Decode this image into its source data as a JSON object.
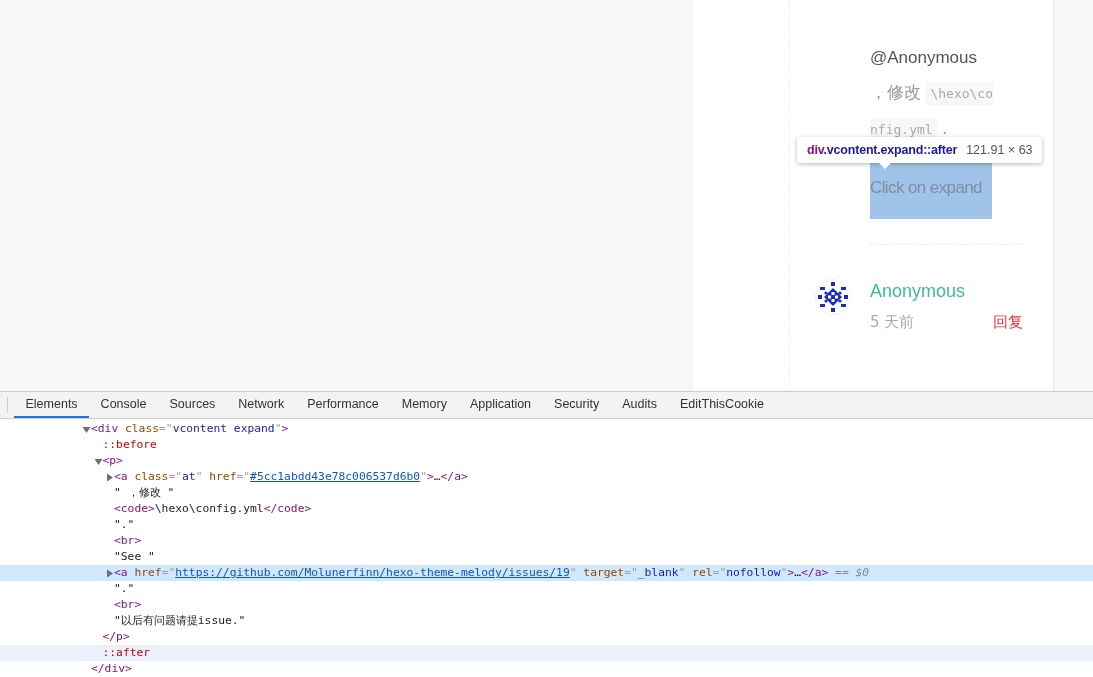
{
  "page": {
    "reply_body": {
      "mention": "@Anonymous",
      "text": " ，修改",
      "code": "\\hexo\\config.yml",
      "end": " ."
    },
    "expand_label": "Click on expand",
    "comment": {
      "author": "Anonymous",
      "time": "5 天前",
      "reply": "回复"
    }
  },
  "inspector_tooltip": {
    "tag": "div",
    "selector": ".vcontent.expand::after",
    "size": "121.91 × 63"
  },
  "devtools": {
    "tabs": [
      {
        "label": "Elements",
        "selected": true
      },
      {
        "label": "Console",
        "selected": false
      },
      {
        "label": "Sources",
        "selected": false
      },
      {
        "label": "Network",
        "selected": false
      },
      {
        "label": "Performance",
        "selected": false
      },
      {
        "label": "Memory",
        "selected": false
      },
      {
        "label": "Application",
        "selected": false
      },
      {
        "label": "Security",
        "selected": false
      },
      {
        "label": "Audits",
        "selected": false
      },
      {
        "label": "EditThisCookie",
        "selected": false
      }
    ],
    "nodes": [
      {
        "segments": [
          {
            "kind": "tag",
            "text": "<div"
          },
          {
            "kind": "attr",
            "text": " class"
          },
          {
            "kind": "punct",
            "text": "=\""
          },
          {
            "kind": "value",
            "text": "vcontent expand"
          },
          {
            "kind": "punct",
            "text": "\""
          },
          {
            "kind": "tag",
            "text": ">"
          }
        ],
        "expanded": true,
        "selected": false,
        "hovered": false,
        "closing": [
          {
            "kind": "tag",
            "text": "</div>"
          }
        ],
        "children": [
          {
            "segments": [
              {
                "kind": "pseudo",
                "text": "::before"
              }
            ],
            "selected": false,
            "hovered": false
          },
          {
            "segments": [
              {
                "kind": "tag",
                "text": "<p>"
              }
            ],
            "expanded": true,
            "selected": false,
            "hovered": false,
            "closing": [
              {
                "kind": "tag",
                "text": "</p>"
              }
            ],
            "children": [
              {
                "segments": [
                  {
                    "kind": "tag",
                    "text": "<a"
                  },
                  {
                    "kind": "attr",
                    "text": " class"
                  },
                  {
                    "kind": "punct",
                    "text": "=\""
                  },
                  {
                    "kind": "value",
                    "text": "at"
                  },
                  {
                    "kind": "punct",
                    "text": "\""
                  },
                  {
                    "kind": "attr",
                    "text": " href"
                  },
                  {
                    "kind": "punct",
                    "text": "=\""
                  },
                  {
                    "kind": "link",
                    "text": "#5cc1abdd43e78c006537d6b0"
                  },
                  {
                    "kind": "punct",
                    "text": "\""
                  },
                  {
                    "kind": "tag",
                    "text": ">"
                  },
                  {
                    "kind": "text",
                    "text": "…"
                  },
                  {
                    "kind": "tag",
                    "text": "</a>"
                  }
                ],
                "expanded": false,
                "selected": false,
                "hovered": false
              },
              {
                "segments": [
                  {
                    "kind": "text",
                    "text": "\" ，修改 \""
                  }
                ],
                "selected": false,
                "hovered": false
              },
              {
                "segments": [
                  {
                    "kind": "tag",
                    "text": "<code>"
                  },
                  {
                    "kind": "text",
                    "text": "\\hexo\\config.yml"
                  },
                  {
                    "kind": "tag",
                    "text": "</code>"
                  }
                ],
                "selected": false,
                "hovered": false
              },
              {
                "segments": [
                  {
                    "kind": "text",
                    "text": "\".\""
                  }
                ],
                "selected": false,
                "hovered": false
              },
              {
                "segments": [
                  {
                    "kind": "tag",
                    "text": "<br>"
                  }
                ],
                "selected": false,
                "hovered": false
              },
              {
                "segments": [
                  {
                    "kind": "text",
                    "text": "\"See \""
                  }
                ],
                "selected": false,
                "hovered": false
              },
              {
                "segments": [
                  {
                    "kind": "tag",
                    "text": "<a"
                  },
                  {
                    "kind": "attr",
                    "text": " href"
                  },
                  {
                    "kind": "punct",
                    "text": "=\""
                  },
                  {
                    "kind": "link",
                    "text": "https://github.com/Molunerfinn/hexo-theme-melody/issues/19"
                  },
                  {
                    "kind": "punct",
                    "text": "\""
                  },
                  {
                    "kind": "attr",
                    "text": " target"
                  },
                  {
                    "kind": "punct",
                    "text": "=\""
                  },
                  {
                    "kind": "value",
                    "text": "_blank"
                  },
                  {
                    "kind": "punct",
                    "text": "\""
                  },
                  {
                    "kind": "attr",
                    "text": " rel"
                  },
                  {
                    "kind": "punct",
                    "text": "=\""
                  },
                  {
                    "kind": "value",
                    "text": "nofollow"
                  },
                  {
                    "kind": "punct",
                    "text": "\""
                  },
                  {
                    "kind": "tag",
                    "text": ">"
                  },
                  {
                    "kind": "text",
                    "text": "…"
                  },
                  {
                    "kind": "tag",
                    "text": "</a>"
                  },
                  {
                    "kind": "meta",
                    "text": " == $0"
                  }
                ],
                "expanded": false,
                "selected": true,
                "hovered": false
              },
              {
                "segments": [
                  {
                    "kind": "text",
                    "text": "\".\""
                  }
                ],
                "selected": false,
                "hovered": false
              },
              {
                "segments": [
                  {
                    "kind": "tag",
                    "text": "<br>"
                  }
                ],
                "selected": false,
                "hovered": false
              },
              {
                "segments": [
                  {
                    "kind": "text",
                    "text": "\"以后有问题请提issue.\""
                  }
                ],
                "selected": false,
                "hovered": false
              }
            ]
          },
          {
            "segments": [
              {
                "kind": "pseudo",
                "text": "::after"
              }
            ],
            "selected": false,
            "hovered": true
          }
        ]
      }
    ]
  }
}
